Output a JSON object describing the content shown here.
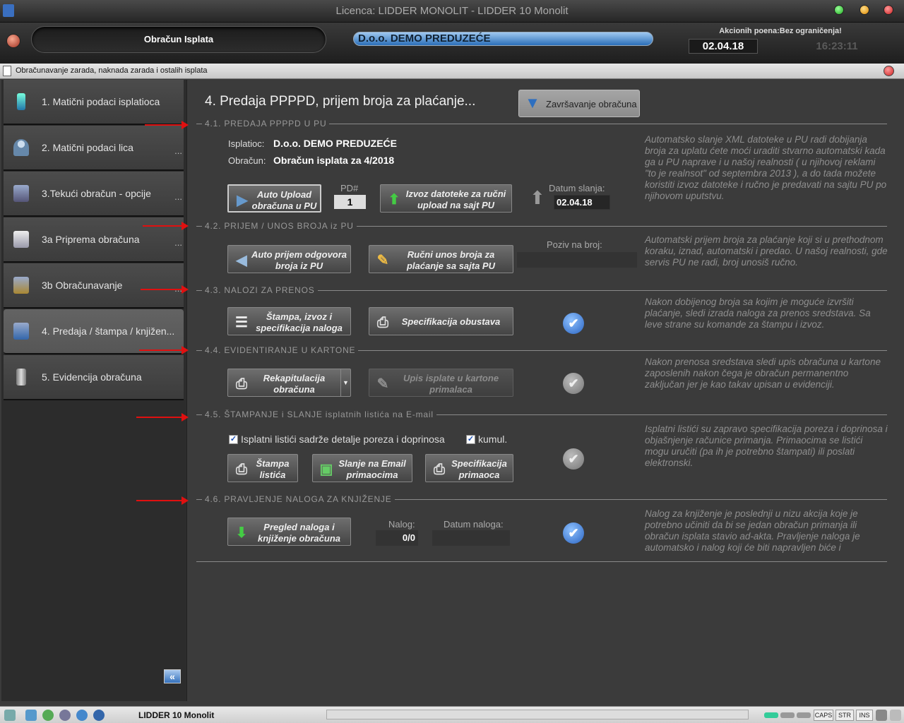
{
  "window": {
    "title": "Licenca: LIDDER MONOLIT - LIDDER 10 Monolit"
  },
  "header": {
    "module": "Obračun Isplata",
    "company": "D.o.o. DEMO PREDUZEĆE",
    "points": "Akcionih poena:Bez ograničenja!",
    "date": "02.04.18",
    "time": "16:23:11"
  },
  "subwindow": {
    "title": "Obračunavanje zarada, naknada zarada i ostalih isplata"
  },
  "sidebar": {
    "items": [
      {
        "label": "1. Matični podaci isplatioca",
        "icon": "bottle-icon"
      },
      {
        "label": "2. Matični podaci lica",
        "icon": "person-icon"
      },
      {
        "label": "3.Tekući obračun - opcije",
        "icon": "database-check-icon"
      },
      {
        "label": "3a Priprema obračuna",
        "icon": "document-database-icon"
      },
      {
        "label": "3b Obračunavanje",
        "icon": "database-gear-icon"
      },
      {
        "label": "4. Predaja / štampa / knjižen...",
        "icon": "database-info-icon"
      },
      {
        "label": "5. Evidencija obračuna",
        "icon": "cylinder-icon"
      }
    ],
    "dots": "...",
    "collapse": "«"
  },
  "main": {
    "title": "4. Predaja PPPPD, prijem broja za plaćanje...",
    "finish_button": "Završavanje obračuna",
    "s41": {
      "header": "4.1. PREDAJA PPPPD U PU",
      "payer_label": "Isplatioc:",
      "payer": "D.o.o. DEMO PREDUZEĆE",
      "calc_label": "Obračun:",
      "calc": "Obračun isplata za 4/2018",
      "auto_upload": "Auto Upload obračuna u PU",
      "pd_label": "PD#",
      "pd_value": "1",
      "export_button": "Izvoz datoteke za ručni upload na sajt PU",
      "send_date_label": "Datum slanja:",
      "send_date": "02.04.18",
      "desc": "Automatsko slanje XML datoteke u PU radi dobijanja broja za uplatu ćete moći uraditi stvarno automatski kada ga u PU naprave i u našoj realnosti ( u njihovoj reklami \"to je realnsot\" od septembra 2013 ), a do tada možete koristiti izvoz datoteke i ručno je predavati na sajtu PU po njihovom uputstvu."
    },
    "s42": {
      "header": "4.2. PRIJEM / UNOS BROJA iz PU",
      "auto_receive": "Auto prijem odgovora broja iz PU",
      "manual_entry": "Ručni unos broja za plaćanje sa sajta PU",
      "ref_label": "Poziv na broj:",
      "desc": "Automatski prijem broja za plaćanje koji si u prethodnom koraku, iznad, automatski i predao. U našoj realnosti, gde servis PU ne radi, broj unosiš ručno."
    },
    "s43": {
      "header": "4.3. NALOZI ZA PRENOS",
      "print_button": "Štampa, izvoz i specifikacija naloga",
      "spec_button": "Specifikacija obustava",
      "desc": "Nakon dobijenog broja sa kojim je moguće izvršiti plaćanje, sledi izrada naloga za prenos sredstava. Sa leve strane su komande za štampu i izvoz."
    },
    "s44": {
      "header": "4.4. EVIDENTIRANJE U KARTONE",
      "recap_button": "Rekapitulacija obračuna",
      "entry_button": "Upis isplate u kartone primalaca",
      "desc": "Nakon prenosa sredstava sledi upis obračuna u kartone zaposlenih nakon čega je obračun permanentno zaključan jer je kao takav upisan u evidenciji."
    },
    "s45": {
      "header": "4.5. ŠTAMPANJE i SLANJE isplatnih listića na E-mail",
      "cb1_label": "Isplatni listići sadrže detalje poreza i doprinosa",
      "cb2_label": "kumul.",
      "print_slips": "Štampa listića",
      "email_button": "Slanje na Email primaocima",
      "spec_recv": "Specifikacija primaoca",
      "desc": "Isplatni listići su zapravo specifikacija poreza i doprinosa i objašnjenje računice primanja. Primaocima se listići mogu uručiti (pa ih je potrebno štampati) ili poslati elektronski."
    },
    "s46": {
      "header": "4.6. PRAVLJENJE NALOGA ZA KNJIŽENJE",
      "review_button": "Pregled naloga i knjiženje obračuna",
      "order_label": "Nalog:",
      "order_value": "0/0",
      "order_date_label": "Datum naloga:",
      "desc": "Nalog za knjiženje je poslednji u nizu akcija koje je potrebno učiniti da bi se jedan obračun primanja ili obračun isplata stavio ad-akta. Pravljenje naloga je automatsko i nalog koji će biti napravljen biće i"
    }
  },
  "statusbar": {
    "app": "LIDDER 10 Monolit",
    "keys": [
      "CAPS",
      "STR",
      "INS"
    ]
  }
}
